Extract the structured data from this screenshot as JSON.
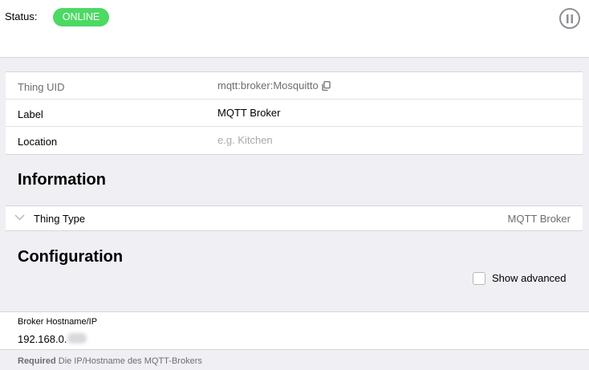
{
  "status": {
    "label": "Status:",
    "badge": "ONLINE",
    "badge_color": "#4cd964",
    "pause_icon": "pause-circle-icon"
  },
  "properties": [
    {
      "key": "Thing UID",
      "value": "mqtt:broker:Mosquitto",
      "icon": "copy-icon"
    },
    {
      "key": "Label",
      "value": "MQTT Broker"
    },
    {
      "key": "Location",
      "placeholder": "e.g. Kitchen"
    }
  ],
  "information": {
    "title": "Information",
    "thing_type": {
      "label": "Thing Type",
      "value": "MQTT Broker",
      "icon": "chevron-down-icon"
    }
  },
  "configuration": {
    "title": "Configuration",
    "show_advanced": "Show advanced",
    "show_advanced_checked": false,
    "broker": {
      "label": "Broker Hostname/IP",
      "value": "192.168.0.",
      "required": "Required",
      "hint": "Die IP/Hostname des MQTT-Brokers"
    }
  }
}
